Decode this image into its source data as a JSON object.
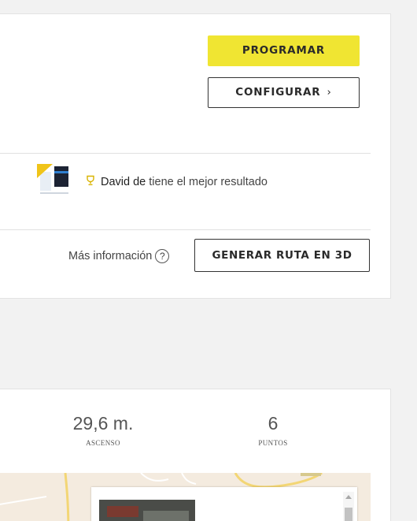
{
  "top_card": {
    "program_label": "PROGRAMAR",
    "configure_label": "CONFIGURAR",
    "configure_chevron": "›",
    "best_result": {
      "name": "David de",
      "text": " tiene el mejor resultado",
      "icon": "trophy-icon"
    },
    "more_info_label": "Más información",
    "help_icon": "question-circle-icon",
    "help_glyph": "?",
    "generate_3d_label": "GENERAR RUTA EN 3D"
  },
  "stats": {
    "ascent": {
      "value": "29,6 m.",
      "label": "ASCENSO"
    },
    "points": {
      "value": "6",
      "label": "PUNTOS"
    }
  },
  "colors": {
    "accent_yellow": "#f0e532",
    "trophy": "#d9b300",
    "page_bg": "#f2f2f2",
    "map_bg": "#f4ebdf",
    "map_road": "#f3d675"
  }
}
